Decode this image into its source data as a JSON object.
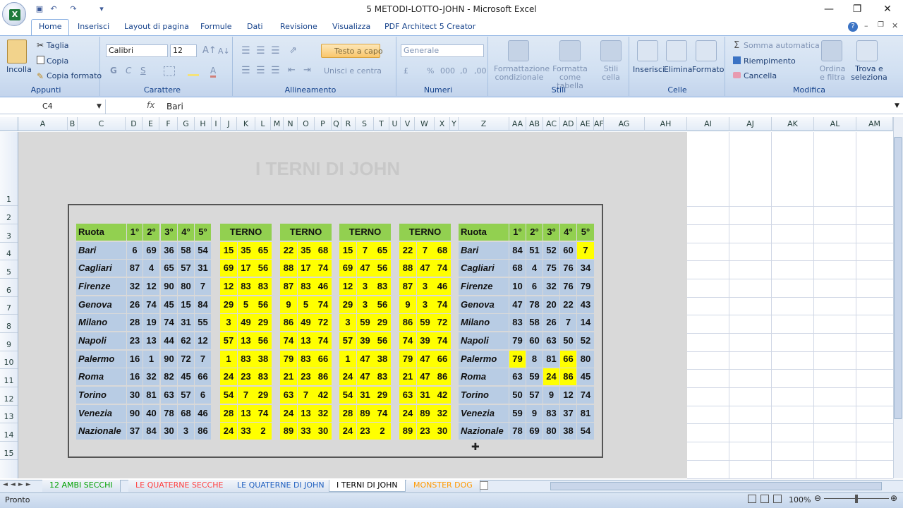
{
  "window": {
    "title": "5 METODI-LOTTO-JOHN - Microsoft Excel"
  },
  "ribbon_tabs": [
    "Home",
    "Inserisci",
    "Layout di pagina",
    "Formule",
    "Dati",
    "Revisione",
    "Visualizza",
    "PDF Architect 5 Creator"
  ],
  "ribbon": {
    "appunti": {
      "label": "Appunti",
      "paste": "Incolla",
      "cut": "Taglia",
      "copy": "Copia",
      "format_painter": "Copia formato"
    },
    "carattere": {
      "label": "Carattere",
      "font": "Calibri",
      "size": "12",
      "bold": "G",
      "italic": "C",
      "underline": "S"
    },
    "allineamento": {
      "label": "Allineamento",
      "wrap": "Testo a capo",
      "merge": "Unisci e centra"
    },
    "numeri": {
      "label": "Numeri",
      "format": "Generale"
    },
    "stili": {
      "label": "Stili",
      "cond": "Formattazione condizionale",
      "table": "Formatta come tabella",
      "cell": "Stili cella"
    },
    "celle": {
      "label": "Celle",
      "insert": "Inserisci",
      "delete": "Elimina",
      "format": "Formato"
    },
    "modifica": {
      "label": "Modifica",
      "autosum": "Somma automatica",
      "fill": "Riempimento",
      "clear": "Cancella",
      "sort": "Ordina e filtra",
      "find": "Trova e seleziona"
    }
  },
  "formula_bar": {
    "name_box": "C4",
    "fx": "fx",
    "content": "Bari"
  },
  "columns": [
    "A",
    "B",
    "C",
    "D",
    "E",
    "F",
    "G",
    "H",
    "I",
    "J",
    "K",
    "L",
    "M",
    "N",
    "O",
    "P",
    "Q",
    "R",
    "S",
    "T",
    "U",
    "V",
    "W",
    "X",
    "Y",
    "Z",
    "AA",
    "AB",
    "AC",
    "AD",
    "AE",
    "AF",
    "AG",
    "AH",
    "AI",
    "AJ",
    "AK",
    "AL",
    "AM"
  ],
  "rows": [
    "1",
    "2",
    "3",
    "4",
    "5",
    "6",
    "7",
    "8",
    "9",
    "10",
    "11",
    "12",
    "13",
    "14",
    "15"
  ],
  "sheet": {
    "title": "I TERNI DI JOHN",
    "left_header": [
      "Ruota",
      "1°",
      "2°",
      "3°",
      "4°",
      "5°"
    ],
    "terno_header": "TERNO",
    "right_header": [
      "Ruota",
      "1°",
      "2°",
      "3°",
      "4°",
      "5°"
    ],
    "wheels": [
      "Bari",
      "Cagliari",
      "Firenze",
      "Genova",
      "Milano",
      "Napoli",
      "Palermo",
      "Roma",
      "Torino",
      "Venezia",
      "Nazionale"
    ],
    "left_numbers": [
      [
        6,
        69,
        36,
        58,
        54
      ],
      [
        87,
        4,
        65,
        57,
        31
      ],
      [
        32,
        12,
        90,
        80,
        7
      ],
      [
        26,
        74,
        45,
        15,
        84
      ],
      [
        28,
        19,
        74,
        31,
        55
      ],
      [
        23,
        13,
        44,
        62,
        12
      ],
      [
        16,
        1,
        90,
        72,
        7
      ],
      [
        16,
        32,
        82,
        45,
        66
      ],
      [
        30,
        81,
        63,
        57,
        6
      ],
      [
        90,
        40,
        78,
        68,
        46
      ],
      [
        37,
        84,
        30,
        3,
        86
      ]
    ],
    "terni": [
      [
        [
          15,
          35,
          65
        ],
        [
          69,
          17,
          56
        ],
        [
          12,
          83,
          83
        ],
        [
          29,
          5,
          56
        ],
        [
          3,
          49,
          29
        ],
        [
          57,
          13,
          56
        ],
        [
          1,
          83,
          38
        ],
        [
          24,
          23,
          83
        ],
        [
          54,
          7,
          29
        ],
        [
          28,
          13,
          74
        ],
        [
          24,
          33,
          2
        ]
      ],
      [
        [
          22,
          35,
          68
        ],
        [
          88,
          17,
          74
        ],
        [
          87,
          83,
          46
        ],
        [
          9,
          5,
          74
        ],
        [
          86,
          49,
          72
        ],
        [
          74,
          13,
          74
        ],
        [
          79,
          83,
          66
        ],
        [
          21,
          23,
          86
        ],
        [
          63,
          7,
          42
        ],
        [
          24,
          13,
          32
        ],
        [
          89,
          33,
          30
        ]
      ],
      [
        [
          15,
          7,
          65
        ],
        [
          69,
          47,
          56
        ],
        [
          12,
          3,
          83
        ],
        [
          29,
          3,
          56
        ],
        [
          3,
          59,
          29
        ],
        [
          57,
          39,
          56
        ],
        [
          1,
          47,
          38
        ],
        [
          24,
          47,
          83
        ],
        [
          54,
          31,
          29
        ],
        [
          28,
          89,
          74
        ],
        [
          24,
          23,
          2
        ]
      ],
      [
        [
          22,
          7,
          68
        ],
        [
          88,
          47,
          74
        ],
        [
          87,
          3,
          46
        ],
        [
          9,
          3,
          74
        ],
        [
          86,
          59,
          72
        ],
        [
          74,
          39,
          74
        ],
        [
          79,
          47,
          66
        ],
        [
          21,
          47,
          86
        ],
        [
          63,
          31,
          42
        ],
        [
          24,
          89,
          32
        ],
        [
          89,
          23,
          30
        ]
      ]
    ],
    "right_numbers": [
      [
        84,
        51,
        52,
        60,
        7
      ],
      [
        68,
        4,
        75,
        76,
        34
      ],
      [
        10,
        6,
        32,
        76,
        79
      ],
      [
        47,
        78,
        20,
        22,
        43
      ],
      [
        83,
        58,
        26,
        7,
        14
      ],
      [
        79,
        60,
        63,
        50,
        52
      ],
      [
        79,
        8,
        81,
        66,
        80
      ],
      [
        63,
        59,
        24,
        86,
        45
      ],
      [
        50,
        57,
        9,
        12,
        74
      ],
      [
        59,
        9,
        83,
        37,
        81
      ],
      [
        78,
        69,
        80,
        38,
        54
      ]
    ],
    "right_highlights": [
      [
        0,
        4
      ],
      [
        6,
        0
      ],
      [
        6,
        3
      ],
      [
        7,
        2
      ],
      [
        7,
        3
      ]
    ]
  },
  "sheet_tabs": [
    {
      "label": "12 AMBI SECCHI",
      "color": "#00a000"
    },
    {
      "label": "LE QUATERNE SECCHE",
      "color": "#ff4040"
    },
    {
      "label": "LE QUATERNE DI JOHN",
      "color": "#1f5fbf"
    },
    {
      "label": "I TERNI DI JOHN",
      "color": "#000000",
      "active": true
    },
    {
      "label": "MONSTER DOG",
      "color": "#ff9900"
    }
  ],
  "status": {
    "ready": "Pronto",
    "zoom": "100%"
  },
  "colors": {
    "green": "#92d050",
    "blue": "#b8cce4",
    "yellow": "#ffff00"
  }
}
